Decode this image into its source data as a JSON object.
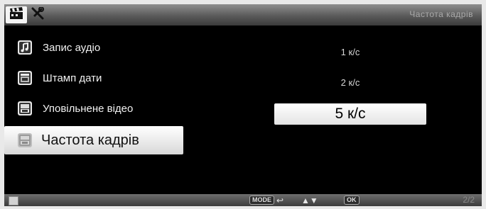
{
  "header": {
    "tabs": [
      {
        "icon": "movie-clapper-icon",
        "active": true
      },
      {
        "icon": "settings-tools-icon",
        "active": false
      }
    ],
    "screen_title": "Частота кадрів"
  },
  "menu": {
    "items": [
      {
        "label": "Запис аудіо",
        "icon": "music-note-icon",
        "selected": false
      },
      {
        "label": "Штамп дати",
        "icon": "calendar-icon",
        "selected": false
      },
      {
        "label": "Уповільнене відео",
        "icon": "slow-motion-icon",
        "selected": false
      },
      {
        "label": "Частота кадрів",
        "icon": "frame-rate-icon",
        "selected": true
      }
    ]
  },
  "options": {
    "items": [
      {
        "label": "1 к/с",
        "selected": false
      },
      {
        "label": "2 к/с",
        "selected": false
      },
      {
        "label": "5 к/с",
        "selected": true
      }
    ]
  },
  "footer": {
    "mode_key": "MODE",
    "back_glyph": "↩",
    "nav_glyph": "▲▼",
    "ok_key": "OK",
    "page_counter": "2/2"
  },
  "colors": {
    "selection": "#ffffff",
    "background": "#000000",
    "bar_gradient_top": "#8f8f8f"
  }
}
